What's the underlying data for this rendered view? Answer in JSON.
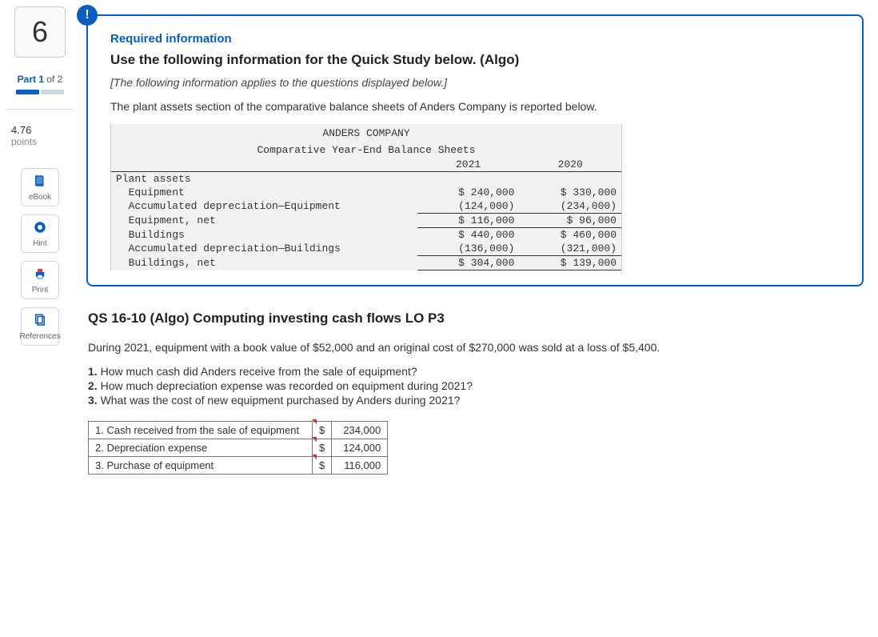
{
  "sidebar": {
    "question_number": "6",
    "part_label_prefix": "Part 1",
    "part_label_suffix": "of 2",
    "points_value": "4.76",
    "points_label": "points",
    "tools": {
      "ebook": "eBook",
      "hint": "Hint",
      "print": "Print",
      "references": "References"
    }
  },
  "alert_glyph": "!",
  "req": {
    "title": "Required information",
    "heading": "Use the following information for the Quick Study below. (Algo)",
    "note": "[The following information applies to the questions displayed below.]",
    "intro": "The plant assets section of the comparative balance sheets of Anders Company is reported below."
  },
  "bs": {
    "company": "ANDERS COMPANY",
    "subtitle": "Comparative Year-End Balance Sheets",
    "year1": "2021",
    "year2": "2020",
    "section": "Plant assets",
    "rows": {
      "equip": {
        "label": "  Equipment",
        "y1": "$ 240,000",
        "y2": "$ 330,000"
      },
      "accdep_e": {
        "label": "  Accumulated depreciation—Equipment",
        "y1": "(124,000)",
        "y2": "(234,000)"
      },
      "equip_net": {
        "label": "  Equipment, net",
        "y1": "$ 116,000",
        "y2": "$ 96,000"
      },
      "build": {
        "label": "  Buildings",
        "y1": "$ 440,000",
        "y2": "$ 460,000"
      },
      "accdep_b": {
        "label": "  Accumulated depreciation—Buildings",
        "y1": "(136,000)",
        "y2": "(321,000)"
      },
      "build_net": {
        "label": "  Buildings, net",
        "y1": "$ 304,000",
        "y2": "$ 139,000"
      }
    }
  },
  "qs": {
    "title": "QS 16-10 (Algo) Computing investing cash flows LO P3",
    "scenario": "During 2021, equipment with a book value of $52,000 and an original cost of $270,000 was sold at a loss of $5,400.",
    "questions": {
      "q1": {
        "num": "1.",
        "text": " How much cash did Anders receive from the sale of equipment?"
      },
      "q2": {
        "num": "2.",
        "text": " How much depreciation expense was recorded on equipment during 2021?"
      },
      "q3": {
        "num": "3.",
        "text": " What was the cost of new equipment purchased by Anders during 2021?"
      }
    }
  },
  "answers": {
    "r1": {
      "label": "1. Cash received from the sale of equipment",
      "cur": "$",
      "val": "234,000"
    },
    "r2": {
      "label": "2. Depreciation expense",
      "cur": "$",
      "val": "124,000"
    },
    "r3": {
      "label": "3. Purchase of equipment",
      "cur": "$",
      "val": "116,000"
    }
  }
}
